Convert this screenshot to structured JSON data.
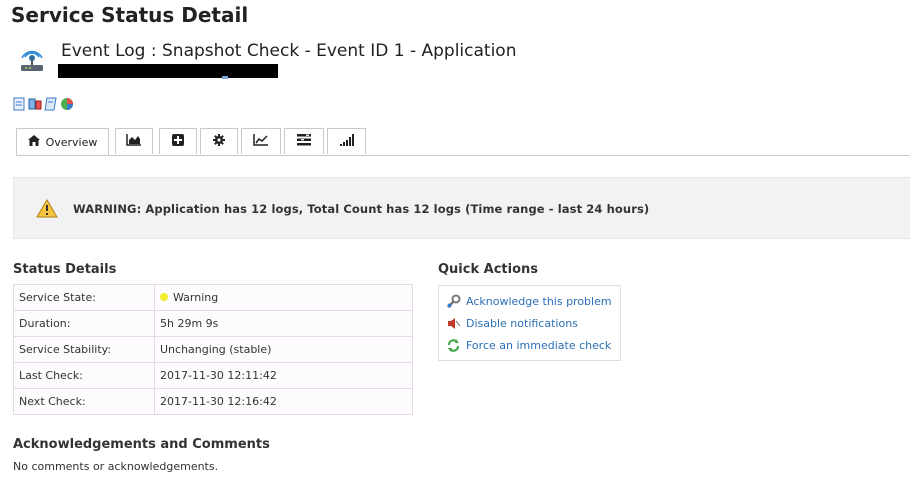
{
  "header": {
    "title": "Service Status Detail",
    "service_name": "Event Log : Snapshot Check - Event ID 1 - Application"
  },
  "toolbar_icons": [
    "document-icon",
    "devices-icon",
    "report-icon",
    "pie-chart-icon"
  ],
  "tabs": [
    {
      "label": "Overview",
      "icon": "home-icon",
      "active": true
    },
    {
      "label": "",
      "icon": "area-chart-icon"
    },
    {
      "label": "",
      "icon": "plus-box-icon"
    },
    {
      "label": "",
      "icon": "gear-icon"
    },
    {
      "label": "",
      "icon": "line-chart-icon"
    },
    {
      "label": "",
      "icon": "list-icon"
    },
    {
      "label": "",
      "icon": "signal-bars-icon"
    }
  ],
  "alert": {
    "text": "WARNING: Application has 12 logs, Total Count has 12 logs (Time range - last 24 hours)",
    "icon": "warning-triangle-icon"
  },
  "status_details": {
    "heading": "Status Details",
    "rows": [
      {
        "label": "Service State:",
        "value": "Warning"
      },
      {
        "label": "Duration:",
        "value": "5h 29m 9s"
      },
      {
        "label": "Service Stability:",
        "value": "Unchanging (stable)"
      },
      {
        "label": "Last Check:",
        "value": "2017-11-30 12:11:42"
      },
      {
        "label": "Next Check:",
        "value": "2017-11-30 12:16:42"
      }
    ],
    "state_color": "#f2ee2c"
  },
  "quick_actions": {
    "heading": "Quick Actions",
    "items": [
      {
        "label": "Acknowledge this problem",
        "icon": "wrench-icon"
      },
      {
        "label": "Disable notifications",
        "icon": "speaker-mute-icon"
      },
      {
        "label": "Force an immediate check",
        "icon": "refresh-icon"
      }
    ]
  },
  "acknowledgements": {
    "heading": "Acknowledgements and Comments",
    "text": "No comments or acknowledgements."
  }
}
